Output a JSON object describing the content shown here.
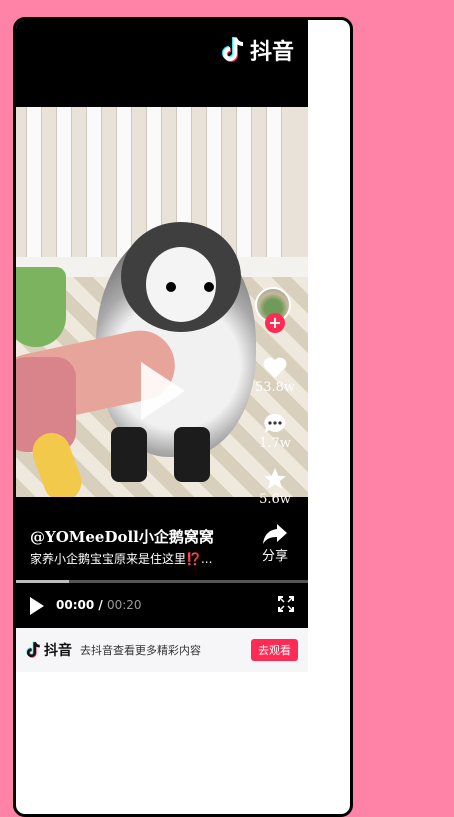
{
  "brand": {
    "name": "抖音"
  },
  "creator": {
    "handle": "@YOMeeDoll小企鹅窝窝"
  },
  "video": {
    "description": "家养小企鹅宝宝原来是住这里⁉️...",
    "progress": 0.18,
    "current_time": "00:00",
    "separator": "/",
    "duration": "00:20"
  },
  "actions": {
    "likes": "53.8w",
    "comments": "1.7w",
    "favorites": "5.6w",
    "share": "分享"
  },
  "banner": {
    "text": "去抖音查看更多精彩内容",
    "button": "去观看"
  },
  "colors": {
    "accent": "#fe2c55",
    "background": "#ff82a7"
  },
  "icons": [
    "douyin-logo-icon",
    "play-icon",
    "heart-icon",
    "comment-icon",
    "star-icon",
    "share-icon",
    "fullscreen-icon"
  ]
}
